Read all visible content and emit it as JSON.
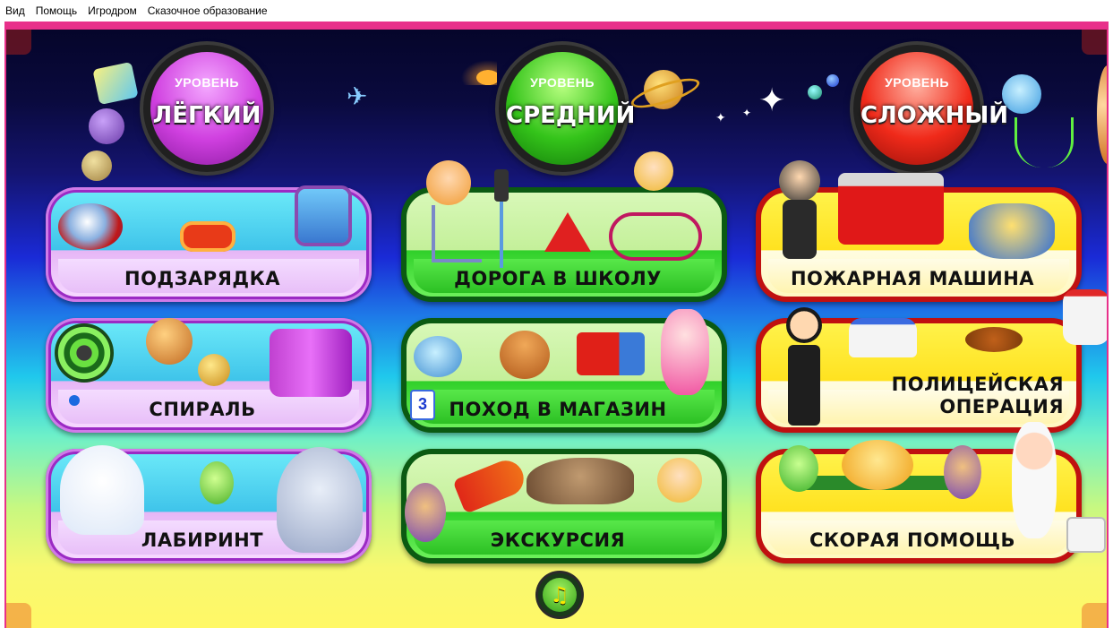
{
  "menu": [
    "Вид",
    "Помощь",
    "Игродром",
    "Сказочное образование"
  ],
  "levels": {
    "caption": "УРОВЕНЬ",
    "easy": "ЛЁГКИЙ",
    "medium": "СРЕДНИЙ",
    "hard": "СЛОЖНЫЙ"
  },
  "games": {
    "easy": [
      "ПОДЗАРЯДКА",
      "СПИРАЛЬ",
      "ЛАБИРИНТ"
    ],
    "medium": [
      "ДОРОГА В ШКОЛУ",
      "ПОХОД В МАГАЗИН",
      "ЭКСКУРСИЯ"
    ],
    "hard_1": "ПОЖАРНАЯ МАШИНА",
    "hard_2_line1": "ПОЛИЦЕЙСКАЯ",
    "hard_2_line2": "ОПЕРАЦИЯ",
    "hard_3": "СКОРАЯ ПОМОЩЬ"
  },
  "price_tag": "3",
  "music_glyph": "♫",
  "colors": {
    "frame": "#e8308a",
    "easy": "#d040e0",
    "medium": "#34c41a",
    "hard": "#f02a1a"
  }
}
